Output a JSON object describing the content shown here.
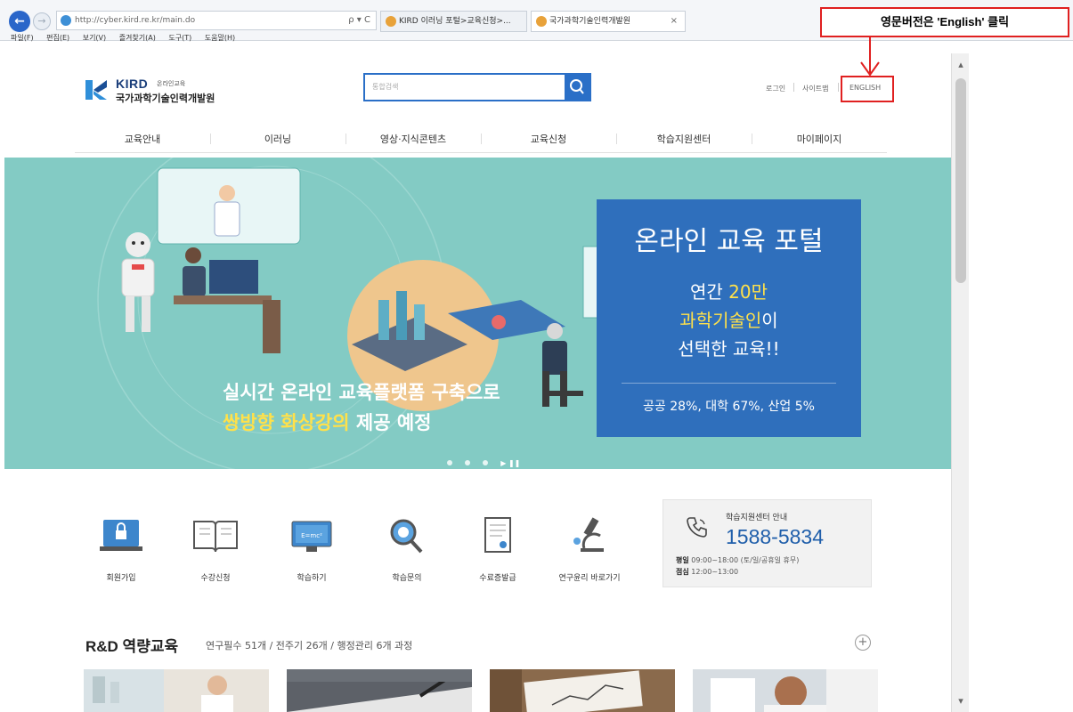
{
  "browser": {
    "address": "http://cyber.kird.re.kr/main.do",
    "address_tools": "ρ ▾ C",
    "tabs": [
      {
        "label": "KIRD 이러닝 포털>교육신청>..."
      },
      {
        "label": "국가과학기술인력개발원",
        "close": "×"
      }
    ],
    "menu": [
      "파일(F)",
      "편집(E)",
      "보기(V)",
      "즐겨찾기(A)",
      "도구(T)",
      "도움말(H)"
    ]
  },
  "annotation": {
    "text": "영문버전은 'English' 클릭",
    "color": "#e02020"
  },
  "header": {
    "logo_kird": "KIRD",
    "logo_sub": "온라인교육",
    "logo_name": "국가과학기술인력개발원",
    "search_placeholder": "통합검색",
    "util_links": [
      "로그인",
      "사이트맵",
      "ENGLISH"
    ]
  },
  "gnb": [
    "교육안내",
    "이러닝",
    "영상·지식콘텐츠",
    "교육신청",
    "학습지원센터",
    "마이페이지"
  ],
  "hero": {
    "panel_title": "온라인 교육 포털",
    "line1_prefix": "연간 ",
    "line1_highlight": "20만",
    "line2_highlight": "과학기술인",
    "line2_suffix": "이",
    "line3": "선택한 교육!!",
    "stat": "공공 28%, 대학 67%, 산업 5%",
    "caption1": "실시간 온라인 교육플랫폼 구축으로",
    "caption2_highlight": "쌍방향 화상강의",
    "caption2_suffix": " 제공 예정",
    "bg_color": "#83cbc4",
    "panel_color": "#2f6fbc",
    "highlight_color": "#ffe14a",
    "pause": "▶ ❚❚"
  },
  "quick_menu": [
    {
      "label": "회원가입",
      "icon": "lock-icon"
    },
    {
      "label": "수강신청",
      "icon": "book-icon"
    },
    {
      "label": "학습하기",
      "icon": "monitor-icon"
    },
    {
      "label": "학습문의",
      "icon": "magnifier-icon"
    },
    {
      "label": "수료증발급",
      "icon": "certificate-icon"
    },
    {
      "label": "연구윤리 바로가기",
      "icon": "microscope-icon"
    }
  ],
  "support": {
    "title": "학습지원센터 안내",
    "number": "1588-5834",
    "hours_label": "평일",
    "hours": "09:00~18:00 (토/일/공휴일 휴무)",
    "lunch_label": "점심",
    "lunch": "12:00~13:00"
  },
  "rd": {
    "title": "R&D 역량교육",
    "subtitle": "연구필수 51개 / 전주기 26개 / 행정관리 6개 과정",
    "plus": "+"
  }
}
